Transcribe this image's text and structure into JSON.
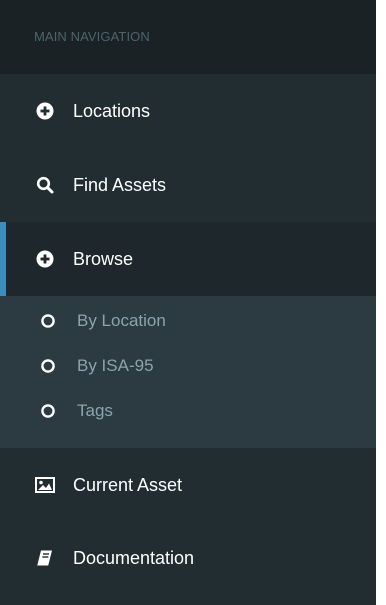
{
  "sidebar": {
    "header": "MAIN NAVIGATION",
    "items": [
      {
        "label": "Locations",
        "icon": "plus-circle-icon"
      },
      {
        "label": "Find Assets",
        "icon": "search-icon"
      },
      {
        "label": "Browse",
        "icon": "plus-circle-icon",
        "active": true
      }
    ],
    "browse_submenu": [
      {
        "label": "By Location",
        "icon": "circle-outline-icon"
      },
      {
        "label": "By ISA-95",
        "icon": "circle-outline-icon"
      },
      {
        "label": "Tags",
        "icon": "circle-outline-icon"
      }
    ],
    "bottom_items": [
      {
        "label": "Current Asset",
        "icon": "image-icon"
      },
      {
        "label": "Documentation",
        "icon": "book-icon"
      }
    ]
  },
  "colors": {
    "sidebar_bg": "#222d32",
    "header_bg": "#1a2226",
    "header_text": "#4b646f",
    "submenu_bg": "#2c3b41",
    "submenu_text": "#8aa4af",
    "active_bg": "#1e282c",
    "active_accent": "#3c8dbc",
    "item_text": "#ffffff"
  }
}
